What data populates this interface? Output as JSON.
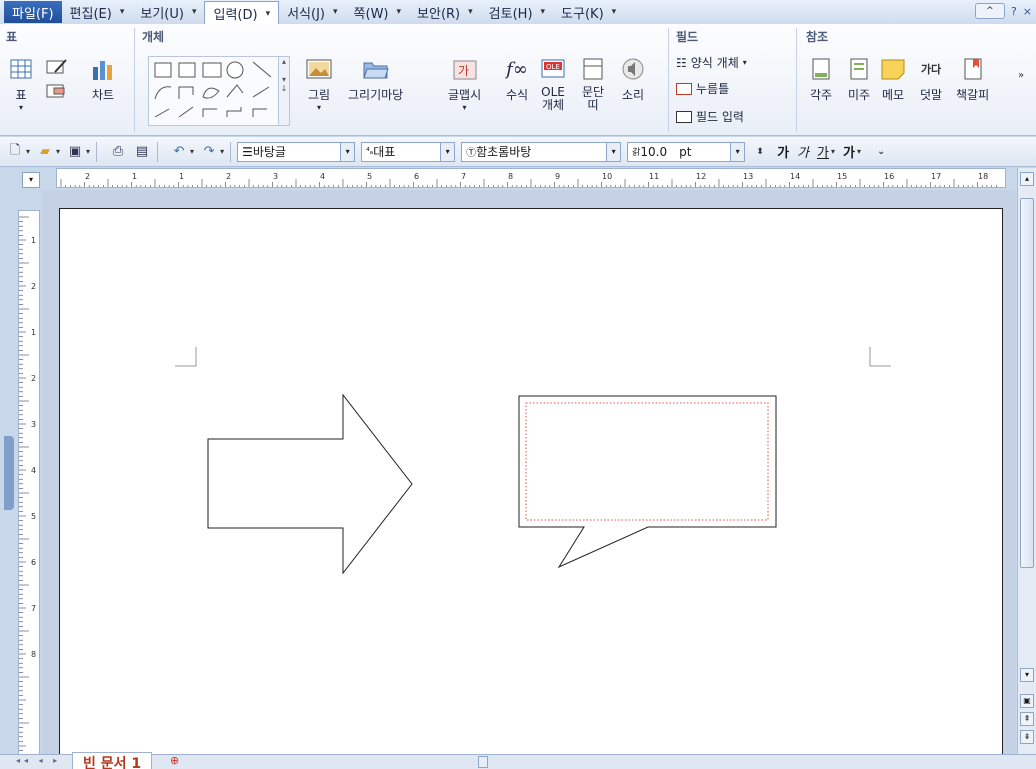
{
  "menu": {
    "items": [
      {
        "label": "파일(F)",
        "caret": false
      },
      {
        "label": "편집(E)",
        "caret": true
      },
      {
        "label": "보기(U)",
        "caret": true
      },
      {
        "label": "입력(D)",
        "caret": true
      },
      {
        "label": "서식(J)",
        "caret": true
      },
      {
        "label": "쪽(W)",
        "caret": true
      },
      {
        "label": "보안(R)",
        "caret": true
      },
      {
        "label": "검토(H)",
        "caret": true
      },
      {
        "label": "도구(K)",
        "caret": true
      }
    ],
    "collapse_symbol": "^",
    "help": "?",
    "close": "×"
  },
  "ribbon": {
    "group_table": "표",
    "group_object": "개체",
    "group_field": "필드",
    "group_ref": "참조",
    "btn_table": "표",
    "btn_chart": "차트",
    "btn_picture": "그림",
    "btn_wizard": "그리기마당",
    "btn_wordart": "글맵시",
    "btn_formula": "수식",
    "btn_ole": "OLE\n개체",
    "btn_para": "문단\n띠",
    "btn_sound": "소리",
    "field_form": "양식 개체",
    "field_click": "누름틀",
    "field_input": "필드 입력",
    "btn_footnote": "각주",
    "btn_endnote": "미주",
    "btn_memo": "메모",
    "btn_overlay": "덧말",
    "btn_bookmark": "책갈피"
  },
  "toolbar": {
    "style": "바탕글",
    "lang": "대표",
    "font": "함초롬바탕",
    "size": "10.0",
    "unit": "pt",
    "bold": "가",
    "italic": "가",
    "underline": "가",
    "strike": "가"
  },
  "ruler": {
    "h_labels": [
      "2",
      "1",
      "1",
      "2",
      "3",
      "4",
      "5",
      "6",
      "7",
      "8",
      "9",
      "10",
      "11",
      "12",
      "13",
      "14",
      "15",
      "16",
      "17",
      "18"
    ],
    "v_labels": [
      "1",
      "2",
      "1",
      "2",
      "3",
      "4",
      "5",
      "6",
      "7",
      "8"
    ]
  },
  "status": {
    "doc_tab": "빈 문서 1"
  },
  "colors": {
    "accent": "#1f4f9a",
    "doc_tab_text": "#b23a1a",
    "callout_dash": "#e0533a"
  }
}
